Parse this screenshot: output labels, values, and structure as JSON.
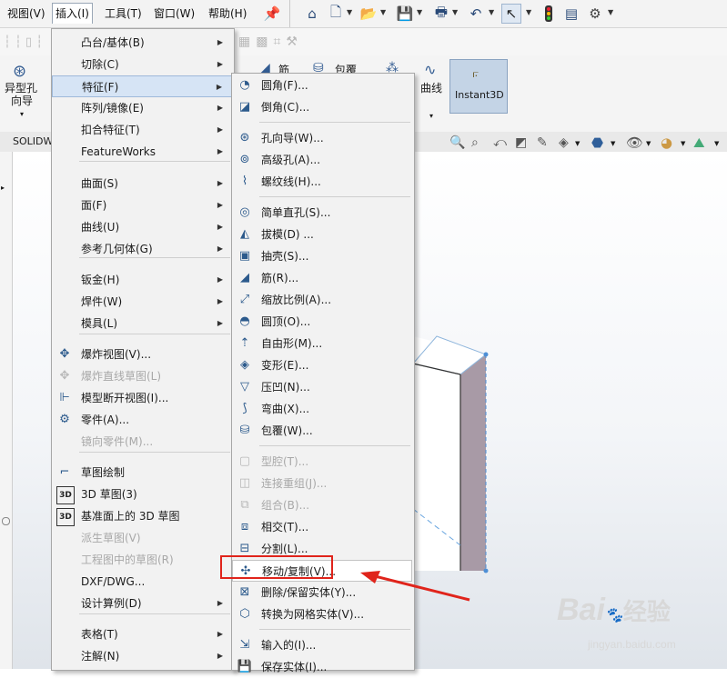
{
  "menubar": {
    "items": [
      "视图(V)",
      "插入(I)",
      "工具(T)",
      "窗口(W)",
      "帮助(H)"
    ],
    "active": "插入(I)"
  },
  "ribbon": {
    "hole_wizard_line1": "异型孔",
    "hole_wizard_line2": "向导",
    "rib_label": "筋",
    "wrap_label": "包覆",
    "curves_label": "曲线",
    "instant3d_label": "Instant3D"
  },
  "tabs": {
    "first": "SOLIDW"
  },
  "insert_menu": {
    "items": [
      {
        "label": "凸台/基体(B)",
        "submenu": true,
        "icon": ""
      },
      {
        "label": "切除(C)",
        "submenu": true,
        "icon": ""
      },
      {
        "label": "特征(F)",
        "submenu": true,
        "icon": "",
        "highlight": true
      },
      {
        "label": "阵列/镜像(E)",
        "submenu": true,
        "icon": ""
      },
      {
        "label": "扣合特征(T)",
        "submenu": true,
        "icon": ""
      },
      {
        "label": "FeatureWorks",
        "submenu": true,
        "icon": ""
      },
      {
        "label": "曲面(S)",
        "submenu": true,
        "icon": "",
        "sep_before": true
      },
      {
        "label": "面(F)",
        "submenu": true,
        "icon": ""
      },
      {
        "label": "曲线(U)",
        "submenu": true,
        "icon": ""
      },
      {
        "label": "参考几何体(G)",
        "submenu": true,
        "icon": ""
      },
      {
        "label": "钣金(H)",
        "submenu": true,
        "icon": "",
        "sep_before": true
      },
      {
        "label": "焊件(W)",
        "submenu": true,
        "icon": ""
      },
      {
        "label": "模具(L)",
        "submenu": true,
        "icon": ""
      },
      {
        "label": "爆炸视图(V)...",
        "submenu": false,
        "icon": "explode-icon",
        "sep_before": true
      },
      {
        "label": "爆炸直线草图(L)",
        "submenu": false,
        "icon": "explode-line-icon",
        "disabled": true
      },
      {
        "label": "模型断开视图(I)...",
        "submenu": false,
        "icon": "break-view-icon"
      },
      {
        "label": "零件(A)...",
        "submenu": false,
        "icon": "part-icon"
      },
      {
        "label": "镜向零件(M)...",
        "submenu": false,
        "icon": "",
        "disabled": true
      },
      {
        "label": "草图绘制",
        "submenu": false,
        "icon": "sketch-icon",
        "sep_before": true
      },
      {
        "label": "3D 草图(3)",
        "submenu": false,
        "icon": "sketch-3d-icon"
      },
      {
        "label": "基准面上的 3D 草图",
        "submenu": false,
        "icon": "sketch-3d-plane-icon"
      },
      {
        "label": "派生草图(V)",
        "submenu": false,
        "icon": "",
        "disabled": true
      },
      {
        "label": "工程图中的草图(R)",
        "submenu": false,
        "icon": "",
        "disabled": true
      },
      {
        "label": "DXF/DWG...",
        "submenu": false,
        "icon": ""
      },
      {
        "label": "设计算例(D)",
        "submenu": true,
        "icon": ""
      },
      {
        "label": "表格(T)",
        "submenu": true,
        "icon": "",
        "sep_before": true
      },
      {
        "label": "注解(N)",
        "submenu": true,
        "icon": ""
      }
    ]
  },
  "features_menu": {
    "items": [
      {
        "label": "圆角(F)...",
        "icon": "fillet-icon"
      },
      {
        "label": "倒角(C)...",
        "icon": "chamfer-icon"
      },
      {
        "label": "孔向导(W)...",
        "icon": "hole-wizard-icon",
        "sep_before": true
      },
      {
        "label": "高级孔(A)...",
        "icon": "advanced-hole-icon"
      },
      {
        "label": "螺纹线(H)...",
        "icon": "thread-icon"
      },
      {
        "label": "简单直孔(S)...",
        "icon": "simple-hole-icon",
        "sep_before": true
      },
      {
        "label": "拔模(D) ...",
        "icon": "draft-icon"
      },
      {
        "label": "抽壳(S)...",
        "icon": "shell-icon"
      },
      {
        "label": "筋(R)...",
        "icon": "rib-icon"
      },
      {
        "label": "缩放比例(A)...",
        "icon": "scale-icon"
      },
      {
        "label": "圆顶(O)...",
        "icon": "dome-icon"
      },
      {
        "label": "自由形(M)...",
        "icon": "freeform-icon"
      },
      {
        "label": "变形(E)...",
        "icon": "deform-icon"
      },
      {
        "label": "压凹(N)...",
        "icon": "indent-icon"
      },
      {
        "label": "弯曲(X)...",
        "icon": "flex-icon"
      },
      {
        "label": "包覆(W)...",
        "icon": "wrap-icon"
      },
      {
        "label": "型腔(T)...",
        "icon": "cavity-icon",
        "disabled": true,
        "sep_before": true
      },
      {
        "label": "连接重组(J)...",
        "icon": "join-icon",
        "disabled": true
      },
      {
        "label": "组合(B)...",
        "icon": "combine-icon",
        "disabled": true
      },
      {
        "label": "相交(T)...",
        "icon": "intersect-icon"
      },
      {
        "label": "分割(L)...",
        "icon": "split-icon"
      },
      {
        "label": "移动/复制(V)...",
        "icon": "move-copy-icon",
        "hover": true
      },
      {
        "label": "删除/保留实体(Y)...",
        "icon": "delete-body-icon"
      },
      {
        "label": "转换为网格实体(V)...",
        "icon": "convert-mesh-icon"
      },
      {
        "label": "输入的(I)...",
        "icon": "imported-icon",
        "sep_before": true
      },
      {
        "label": "保存实体(I)...",
        "icon": "save-bodies-icon"
      }
    ]
  },
  "watermark": {
    "brand": "Bai",
    "brand_suffix": "经验",
    "url": "jingyan.baidu.com"
  },
  "colors": {
    "highlight": "#d6e4f5",
    "annotation_red": "#e0241b",
    "part_face": "#a89aa6"
  }
}
